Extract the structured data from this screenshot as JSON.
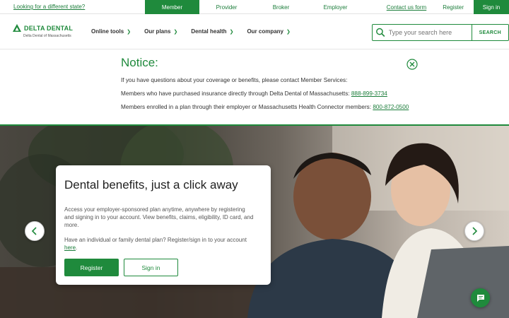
{
  "topbar": {
    "state_link": "Looking for a different state?",
    "audience_tabs": [
      "Member",
      "Provider",
      "Broker",
      "Employer"
    ],
    "active_tab": "Member",
    "contact_link": "Contact us form",
    "register_link": "Register",
    "signin_label": "Sign in"
  },
  "header": {
    "logo_name": "DELTA DENTAL",
    "logo_sub": "Delta Dental of Massachusetts",
    "nav": [
      "Online tools",
      "Our plans",
      "Dental health",
      "Our company"
    ],
    "search": {
      "placeholder": "Type your search here",
      "button_label": "SEARCH"
    }
  },
  "notice": {
    "title": "Notice:",
    "line1": "If you have questions about your coverage or benefits, please contact Member Services:",
    "line2_text": "Members who have purchased insurance directly through Delta Dental of Massachusetts: ",
    "line2_phone": "888-899-3734",
    "line3_text": "Members enrolled in a plan through their employer or Massachusetts Health Connector members: ",
    "line3_phone": "800-872-0500"
  },
  "hero": {
    "title": "Dental benefits, just a click away",
    "paragraph1": "Access your employer-sponsored plan anytime, anywhere by registering and signing in to your account. View benefits, claims, eligibility, ID card, and more.",
    "paragraph2_text": "Have an individual or family dental plan? Register/sign in to your account ",
    "paragraph2_link": "here",
    "paragraph2_end": ".",
    "register_label": "Register",
    "signin_label": "Sign in"
  },
  "icons": {
    "logo": "delta-triangle-icon",
    "search": "search-icon",
    "close": "close-circle-icon",
    "prev": "chevron-left-icon",
    "next": "chevron-right-icon",
    "chat": "chat-bubble-icon"
  },
  "colors": {
    "brand_green": "#1f8a3c",
    "link_green": "#1b7d3a"
  }
}
